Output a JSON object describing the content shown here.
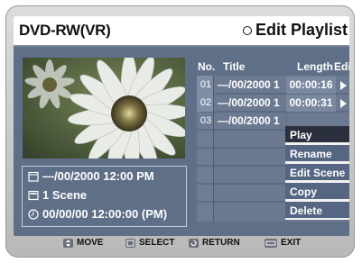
{
  "header": {
    "device": "DVD-RW(VR)",
    "title": "Edit Playlist"
  },
  "columns": {
    "no": "No.",
    "title": "Title",
    "length": "Length",
    "edit": "Edit"
  },
  "rows": [
    {
      "no": "01",
      "title": "—/00/2000 1",
      "length": "00:00:16"
    },
    {
      "no": "02",
      "title": "—/00/2000 1",
      "length": "00:00:31"
    },
    {
      "no": "03",
      "title": "—/00/2000 1",
      "length": ""
    }
  ],
  "menu": {
    "items": [
      "Play",
      "Rename",
      "Edit Scene",
      "Copy",
      "Delete"
    ],
    "selected": "Play"
  },
  "info": {
    "date": "—/00/2000 12:00 PM",
    "scenes": "1 Scene",
    "duration": "00/00/00 12:00:00 (PM)"
  },
  "footer": {
    "move": "MOVE",
    "select": "SELECT",
    "return": "RETURN",
    "exit": "EXIT"
  },
  "icons": {
    "thumbnail": "flower-thumbnail",
    "date": "calendar-icon",
    "scenes": "film-icon",
    "duration": "clock-icon"
  },
  "colors": {
    "screen_bg": "#5f6f88",
    "row_bg": "#6f7e96",
    "selected_menu": "#2a2f3e",
    "menu_item": "#566582"
  }
}
